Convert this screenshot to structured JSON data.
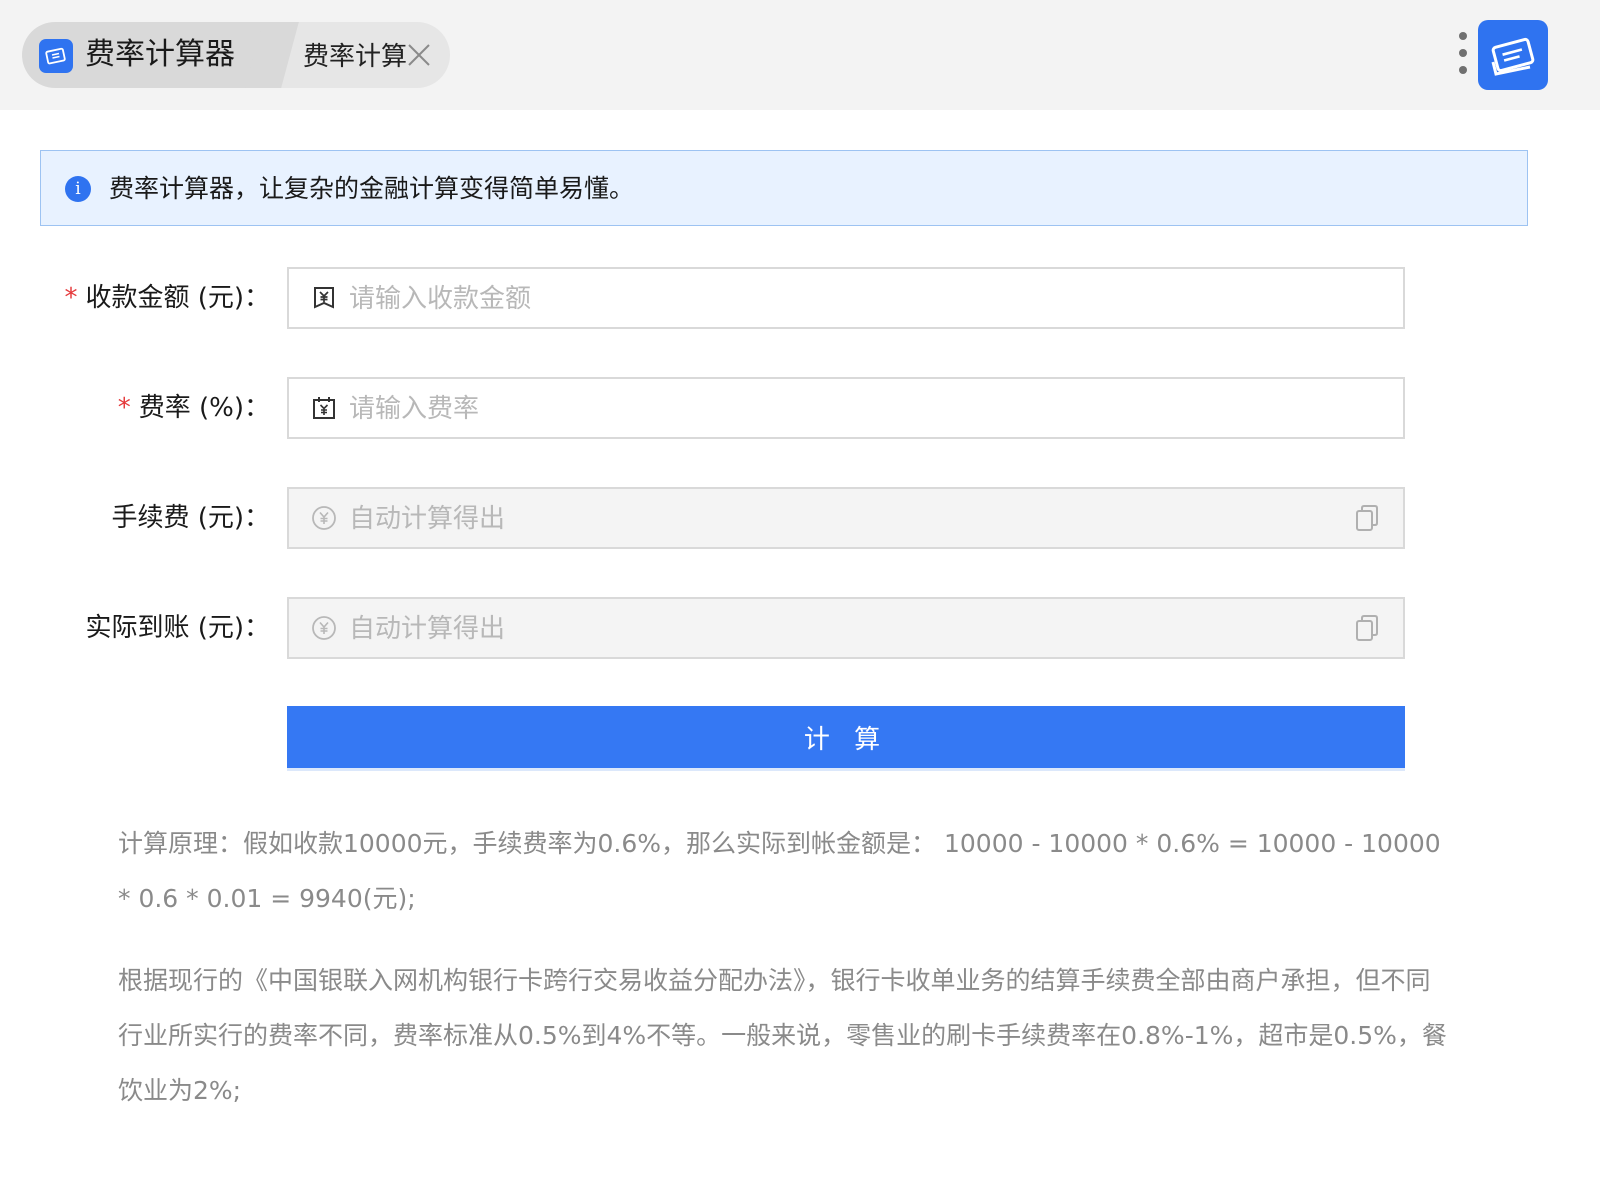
{
  "topbar": {
    "tab_title": "费率计算器",
    "tab_subtitle": "费率计算"
  },
  "info": {
    "text": "费率计算器，让复杂的金融计算变得简单易懂。"
  },
  "form": {
    "amount": {
      "label": "收款金额 (元)：",
      "placeholder": "请输入收款金额",
      "required": true
    },
    "rate": {
      "label": "费率 (%)：",
      "placeholder": "请输入费率",
      "required": true
    },
    "fee": {
      "label": "手续费 (元)：",
      "placeholder": "自动计算得出",
      "disabled": true
    },
    "actual": {
      "label": "实际到账 (元)：",
      "placeholder": "自动计算得出",
      "disabled": true
    },
    "required_mark": "*",
    "submit_label": "计 算"
  },
  "description": {
    "principle": "计算原理：假如收款10000元，手续费率为0.6%，那么实际到帐金额是： 10000 - 10000 * 0.6% = 10000 - 10000 * 0.6 * 0.01 = 9940(元);",
    "regulation": "根据现行的《中国银联入网机构银行卡跨行交易收益分配办法》，银行卡收单业务的结算手续费全部由商户承担，但不同行业所实行的费率不同，费率标准从0.5%到4%不等。一般来说，零售业的刷卡手续费率在0.8%-1%，超市是0.5%，餐饮业为2%;"
  },
  "icons": {
    "app": "ticket-icon",
    "close": "close-icon",
    "more": "more-vertical-icon",
    "info": "info-icon",
    "amount": "yuan-doc-icon",
    "rate": "yuan-calendar-icon",
    "result": "yuan-circle-icon",
    "copy": "copy-icon"
  },
  "colors": {
    "accent": "#3578f3",
    "required": "#e5393b",
    "info_bg": "#e8f2ff",
    "info_border": "#9dc3f2",
    "muted_text": "#8a8a8a"
  }
}
